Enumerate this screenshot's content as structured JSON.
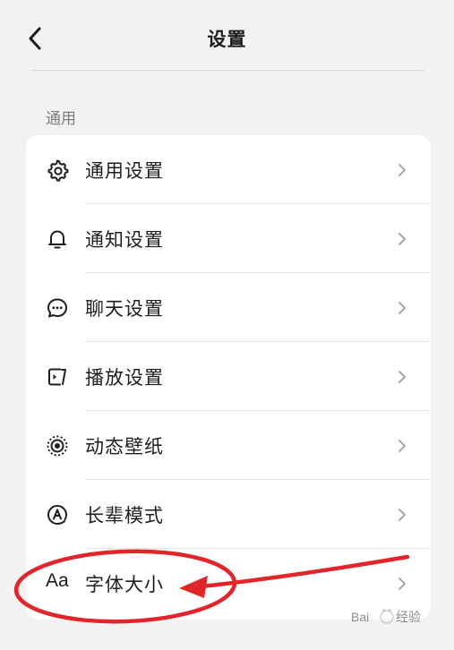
{
  "header": {
    "title": "设置"
  },
  "section": {
    "title": "通用"
  },
  "items": [
    {
      "label": "通用设置",
      "icon": "gear-icon"
    },
    {
      "label": "通知设置",
      "icon": "bell-icon"
    },
    {
      "label": "聊天设置",
      "icon": "chat-bubble-icon"
    },
    {
      "label": "播放设置",
      "icon": "play-settings-icon"
    },
    {
      "label": "动态壁纸",
      "icon": "live-wallpaper-icon"
    },
    {
      "label": "长辈模式",
      "icon": "elder-mode-icon"
    },
    {
      "label": "字体大小",
      "icon": "font-size-icon",
      "icon_text": "Aa"
    }
  ],
  "watermark": {
    "text": "Bai",
    "text2": "经验"
  },
  "colors": {
    "background": "#f2f2f2",
    "card": "#ffffff",
    "annotation": "#e0262a"
  }
}
